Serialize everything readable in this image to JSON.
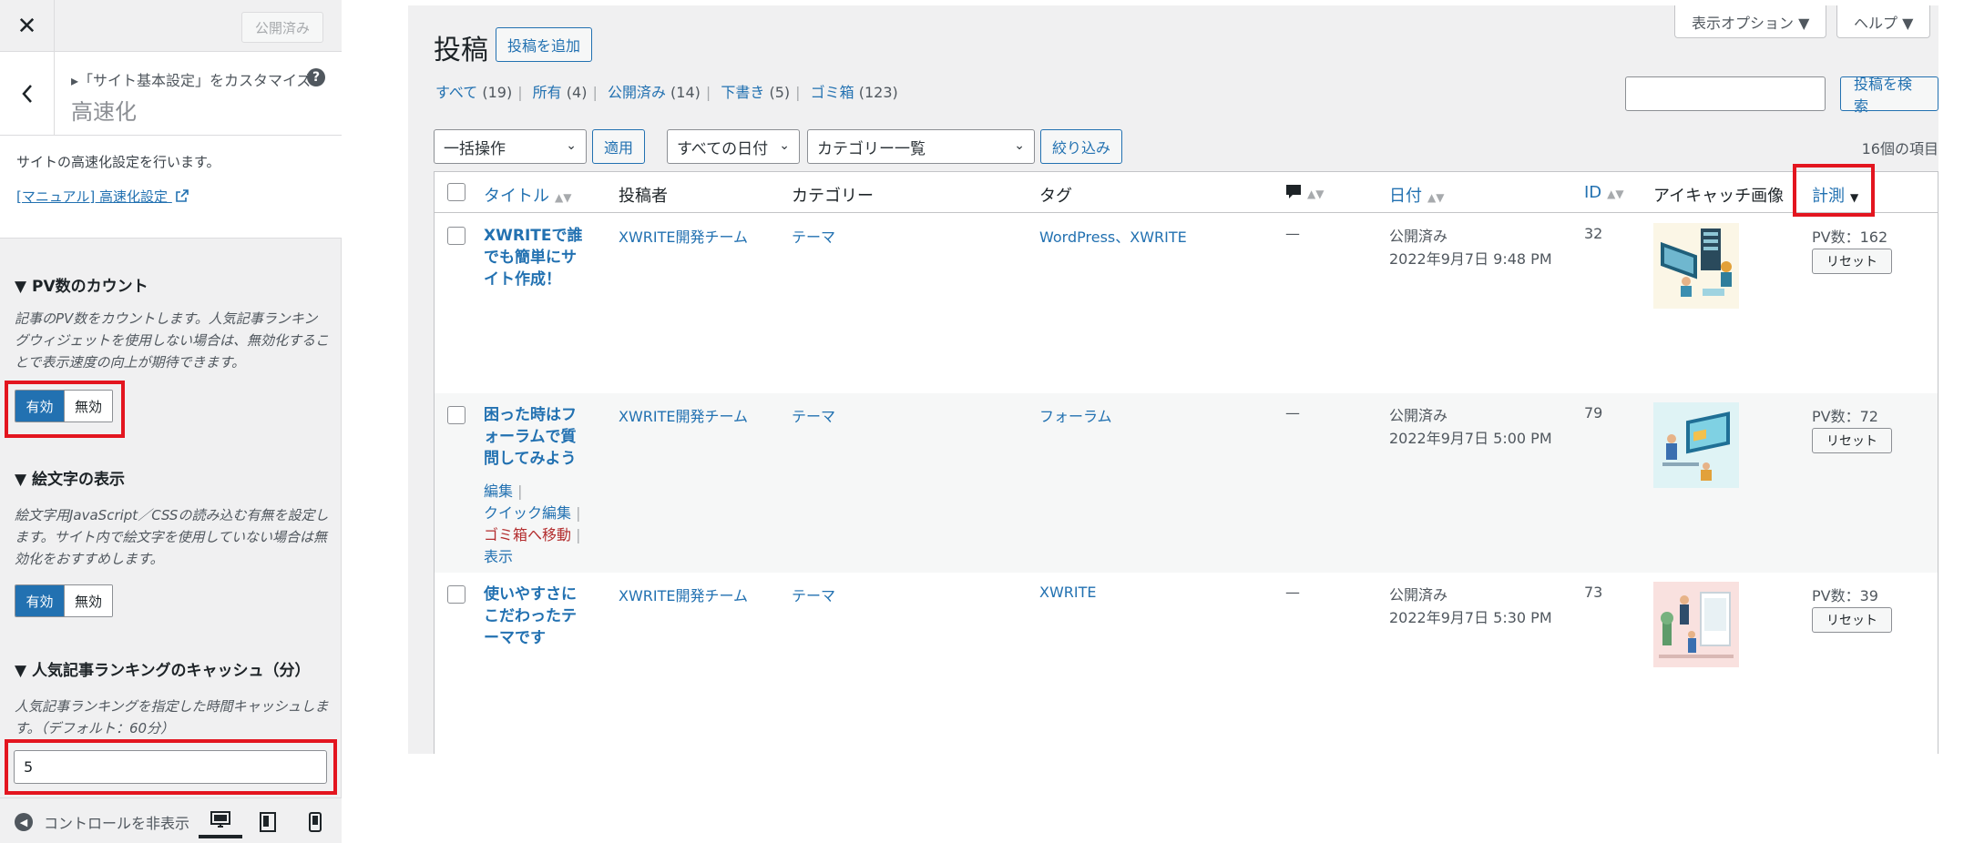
{
  "customizer": {
    "close_label": "✕",
    "publish_label": "公開済み",
    "breadcrumb": "▸「サイト基本設定」をカスタマイズ",
    "help_icon": "?",
    "section_title": "高速化",
    "description": "サイトの高速化設定を行います。",
    "manual_link": "[マニュアル] 高速化設定",
    "controls": [
      {
        "title": "▼ PV数のカウント",
        "description": "記事のPV数をカウントします。人気記事ランキングウィジェットを使用しない場合は、無効化することで表示速度の向上が期待できます。",
        "on_label": "有効",
        "off_label": "無効"
      },
      {
        "title": "▼ 絵文字の表示",
        "description": "絵文字用JavaScript／CSSの読み込む有無を設定します。サイト内で絵文字を使用していない場合は無効化をおすすめします。",
        "on_label": "有効",
        "off_label": "無効"
      },
      {
        "title": "▼ 人気記事ランキングのキャッシュ（分）",
        "description": "人気記事ランキングを指定した時間キャッシュします。（デフォルト：60分）",
        "value": "5"
      }
    ],
    "footer": {
      "hide_controls_label": "コントロールを非表示"
    }
  },
  "posts": {
    "screen_options": "表示オプション ▼",
    "help": "ヘルプ ▼",
    "title": "投稿",
    "add_new": "投稿を追加",
    "filters": [
      {
        "label": "すべて",
        "count": "(19)"
      },
      {
        "label": "所有",
        "count": "(4)"
      },
      {
        "label": "公開済み",
        "count": "(14)"
      },
      {
        "label": "下書き",
        "count": "(5)"
      },
      {
        "label": "ゴミ箱",
        "count": "(123)"
      }
    ],
    "search_button": "投稿を検索",
    "bulk_action": "一括操作",
    "apply": "適用",
    "dates": "すべての日付",
    "categories": "カテゴリー一覧",
    "filter_button": "絞り込み",
    "items_count": "16個の項目",
    "columns": {
      "title": "タイトル",
      "author": "投稿者",
      "category": "カテゴリー",
      "tags": "タグ",
      "date": "日付",
      "id": "ID",
      "thumbnail": "アイキャッチ画像",
      "measure": "計測"
    },
    "rows": [
      {
        "title": "XWRITEで誰でも簡単にサイト作成！",
        "author": "XWRITE開発チーム",
        "category": "テーマ",
        "tags": "WordPress、XWRITE",
        "comments": "—",
        "status": "公開済み",
        "date": "2022年9月7日 9:48 PM",
        "id": "32",
        "pv": "PV数：162",
        "reset": "リセット"
      },
      {
        "title": "困った時はフォーラムで質問してみよう",
        "author": "XWRITE開発チーム",
        "category": "テーマ",
        "tags": "フォーラム",
        "comments": "—",
        "status": "公開済み",
        "date": "2022年9月7日 5:00 PM",
        "id": "79",
        "pv": "PV数：72",
        "reset": "リセット",
        "actions": {
          "edit": "編集",
          "quick_edit": "クイック編集",
          "trash": "ゴミ箱へ移動",
          "view": "表示"
        }
      },
      {
        "title": "使いやすさにこだわったテーマです",
        "author": "XWRITE開発チーム",
        "category": "テーマ",
        "tags": "XWRITE",
        "comments": "—",
        "status": "公開済み",
        "date": "2022年9月7日 5:30 PM",
        "id": "73",
        "pv": "PV数：39",
        "reset": "リセット"
      }
    ]
  },
  "colors": {
    "accent": "#2271b1",
    "highlight": "#e3151f",
    "danger": "#b32d2e"
  }
}
